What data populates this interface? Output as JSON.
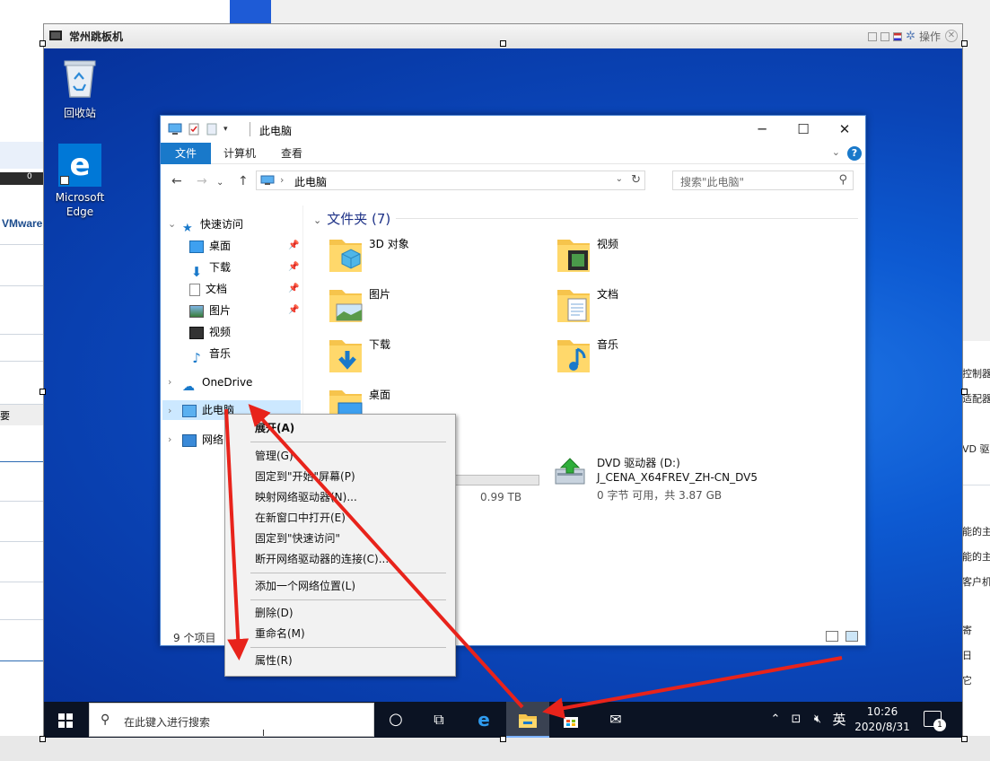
{
  "host": {
    "vmware_label": "VMware",
    "right_labels": [
      "控制器",
      "适配器",
      "VD 驱动",
      "能的主",
      "能的主",
      "客户机",
      "寄",
      "日",
      "它"
    ],
    "left_label": "要",
    "dark_btn": "0"
  },
  "vm": {
    "title": "常州跳板机",
    "action_label": "操作"
  },
  "desktop": {
    "recycle_bin": "回收站",
    "edge": "Microsoft Edge",
    "edge_glyph": "e"
  },
  "explorer": {
    "title": "此电脑",
    "tabs": {
      "file": "文件",
      "computer": "计算机",
      "view": "查看"
    },
    "help": "?",
    "address": "此电脑",
    "search_placeholder": "搜索\"此电脑\"",
    "nav": {
      "quick_access": "快速访问",
      "desktop": "桌面",
      "downloads": "下载",
      "documents": "文档",
      "pictures": "图片",
      "videos": "视频",
      "music": "音乐",
      "onedrive": "OneDrive",
      "this_pc": "此电脑",
      "network": "网络"
    },
    "group_folders": "文件夹 (7)",
    "folders": [
      {
        "label": "3D 对象",
        "icon": "3d-objects-folder-icon"
      },
      {
        "label": "视频",
        "icon": "videos-folder-icon"
      },
      {
        "label": "图片",
        "icon": "pictures-folder-icon"
      },
      {
        "label": "文档",
        "icon": "documents-folder-icon"
      },
      {
        "label": "下载",
        "icon": "downloads-folder-icon"
      },
      {
        "label": "音乐",
        "icon": "music-folder-icon"
      },
      {
        "label": "桌面",
        "icon": "desktop-folder-icon"
      }
    ],
    "drive_c_text": "0.99 TB",
    "drive_d": {
      "title": "DVD 驱动器 (D:)",
      "label": "J_CENA_X64FREV_ZH-CN_DV5",
      "space": "0 字节 可用，共 3.87 GB"
    },
    "status_count": "9 个项目"
  },
  "context_menu": {
    "items": [
      {
        "label": "展开(A)",
        "bold": true
      },
      {
        "label": "管理(G)"
      },
      {
        "label": "固定到\"开始\"屏幕(P)"
      },
      {
        "label": "映射网络驱动器(N)..."
      },
      {
        "label": "在新窗口中打开(E)"
      },
      {
        "label": "固定到\"快速访问\""
      },
      {
        "label": "断开网络驱动器的连接(C)..."
      },
      {
        "label": "添加一个网络位置(L)"
      },
      {
        "label": "删除(D)"
      },
      {
        "label": "重命名(M)"
      },
      {
        "label": "属性(R)"
      }
    ]
  },
  "taskbar": {
    "search_placeholder": "在此键入进行搜索",
    "ime": "英",
    "time": "10:26",
    "date": "2020/8/31",
    "notification_count": "1"
  },
  "colors": {
    "accent": "#1979ca",
    "annotation_red": "#e8231b",
    "taskbar": "#0b1323"
  }
}
